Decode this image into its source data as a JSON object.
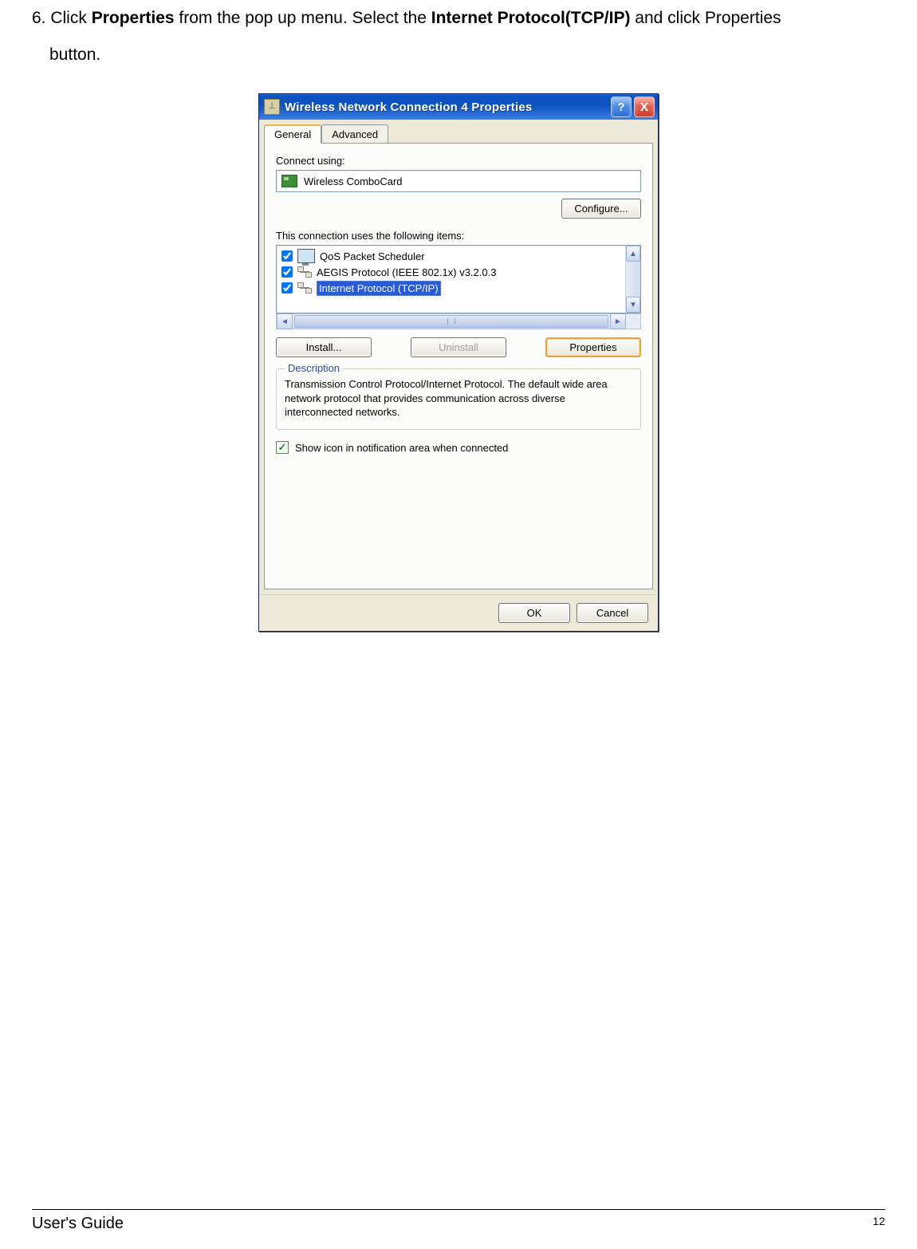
{
  "instruction": {
    "num": "6.",
    "t1": " Click ",
    "b1": "Properties",
    "t2": " from the pop up menu. Select the ",
    "b2": "Internet Protocol(TCP/IP)",
    "t3": " and click Properties",
    "line2": "button."
  },
  "dialog": {
    "title": "Wireless Network Connection 4 Properties",
    "help": "?",
    "close": "X",
    "tabs": {
      "general": "General",
      "advanced": "Advanced"
    },
    "connect_label": "Connect using:",
    "adapter": "Wireless ComboCard",
    "configure": "Configure...",
    "items_label": "This connection uses the following items:",
    "items": [
      {
        "label": "QoS Packet Scheduler",
        "selected": false,
        "iconType": "monitor"
      },
      {
        "label": "AEGIS Protocol (IEEE 802.1x) v3.2.0.3",
        "selected": false,
        "iconType": "net"
      },
      {
        "label": "Internet Protocol (TCP/IP)",
        "selected": true,
        "iconType": "net"
      }
    ],
    "install": "Install...",
    "uninstall": "Uninstall",
    "properties": "Properties",
    "desc_legend": "Description",
    "desc_text": "Transmission Control Protocol/Internet Protocol. The default wide area network protocol that provides communication across diverse interconnected networks.",
    "show_icon": "Show icon in notification area when connected",
    "ok": "OK",
    "cancel": "Cancel"
  },
  "footer": {
    "guide": "User's Guide",
    "page": "12"
  }
}
